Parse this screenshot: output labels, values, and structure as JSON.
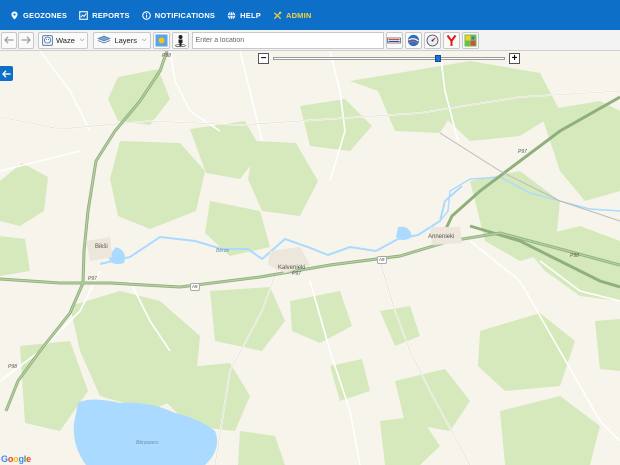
{
  "nav": {
    "items": [
      {
        "label": "GEOZONES",
        "icon": "map-pin-icon"
      },
      {
        "label": "REPORTS",
        "icon": "report-chart-icon"
      },
      {
        "label": "NOTIFICATIONS",
        "icon": "info-circle-icon"
      },
      {
        "label": "HELP",
        "icon": "globe-icon"
      },
      {
        "label": "ADMIN",
        "icon": "tools-icon"
      }
    ],
    "admin_color": "#f5d33a",
    "bar_color": "#0e6fc9"
  },
  "toolbar": {
    "map_source": "Waze",
    "layers_label": "Layers",
    "location_placeholder": "Enter a location"
  },
  "map": {
    "places": {
      "bikisi": "Bikši",
      "kalvenieki": "Kalvenieki",
      "annenieki": "Annenieki",
      "lake": "Bērzezers",
      "river": "Bērze"
    },
    "roads": {
      "p97_east": "P97",
      "p97_west": "P97",
      "p97_kalv": "P97",
      "p98_east": "P98",
      "p98_south": "P98",
      "p98_north": "P98",
      "a9_a": "A9",
      "a9_b": "A9"
    },
    "attribution": "Google"
  }
}
